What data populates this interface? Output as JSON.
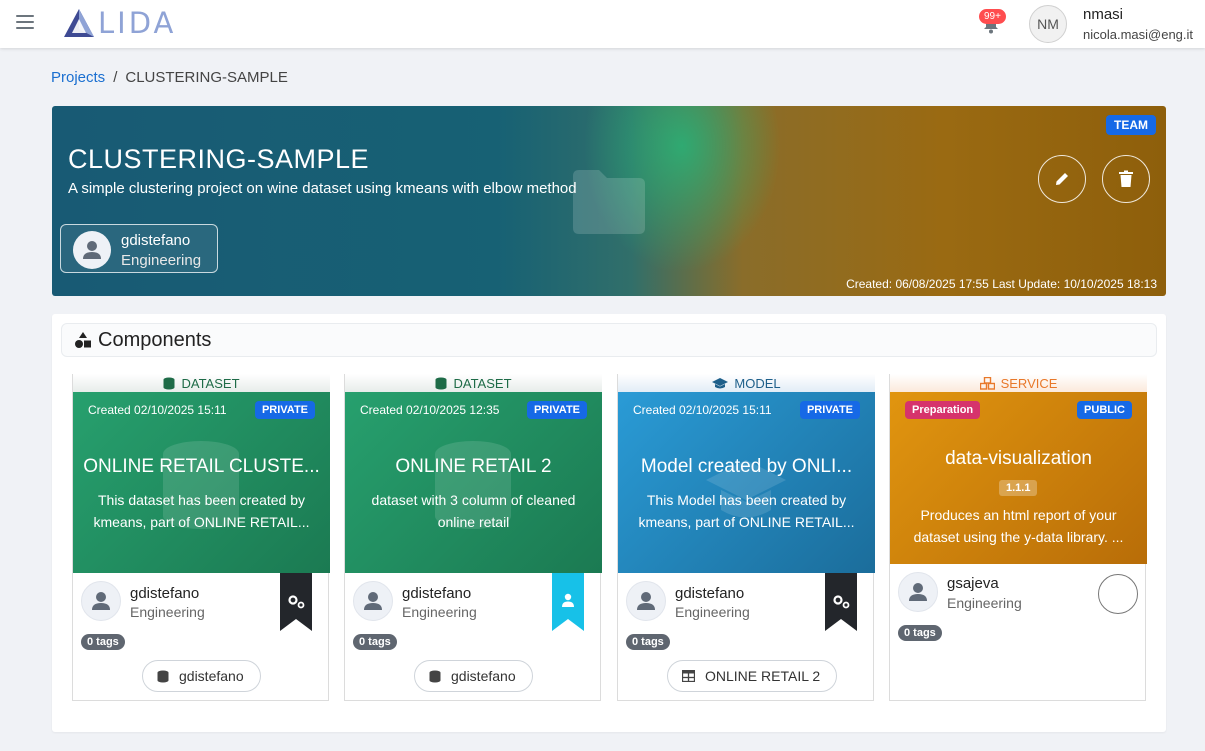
{
  "app": {
    "logo_text": "LIDA",
    "notifications_count": "99+",
    "user": {
      "initials": "NM",
      "name": "nmasi",
      "email": "nicola.masi@eng.it"
    }
  },
  "breadcrumb": {
    "root": "Projects",
    "separator": "/",
    "current": "CLUSTERING-SAMPLE"
  },
  "project": {
    "badge": "TEAM",
    "title": "CLUSTERING-SAMPLE",
    "description": "A simple clustering project on wine dataset using kmeans with elbow method",
    "owner": {
      "name": "gdistefano",
      "role": "Engineering"
    },
    "dates": "Created: 06/08/2025 17:55   Last Update: 10/10/2025 18:13"
  },
  "components": {
    "title": "Components",
    "cards": [
      {
        "type": "DATASET",
        "type_color": "#1e6b47",
        "created": "Created 02/10/2025 15:11",
        "visibility": "PRIVATE",
        "title": "ONLINE RETAIL CLUSTE...",
        "description": "This dataset has been created by kmeans, part of ONLINE RETAIL...",
        "owner": "gdistefano",
        "role": "Engineering",
        "tags": "0 tags",
        "source": "gdistefano",
        "ribbon": "dark"
      },
      {
        "type": "DATASET",
        "type_color": "#1e6b47",
        "created": "Created 02/10/2025 12:35",
        "visibility": "PRIVATE",
        "title": "ONLINE RETAIL 2",
        "description": "dataset with 3 column of cleaned online retail",
        "owner": "gdistefano",
        "role": "Engineering",
        "tags": "0 tags",
        "source": "gdistefano",
        "ribbon": "cyan"
      },
      {
        "type": "MODEL",
        "type_color": "#1e5f8a",
        "created": "Created 02/10/2025 15:11",
        "visibility": "PRIVATE",
        "title": "Model created by ONLI...",
        "description": "This Model has been created by kmeans, part of ONLINE RETAIL...",
        "owner": "gdistefano",
        "role": "Engineering",
        "tags": "0 tags",
        "source": "ONLINE RETAIL 2",
        "ribbon": "dark"
      },
      {
        "type": "SERVICE",
        "type_color": "#e8782a",
        "status": "Preparation",
        "visibility": "PUBLIC",
        "title": "data-visualization",
        "version": "1.1.1",
        "description": "Produces an html report of your dataset using the y-data library. ...",
        "owner": "gsajeva",
        "role": "Engineering",
        "tags": "0 tags"
      }
    ]
  }
}
